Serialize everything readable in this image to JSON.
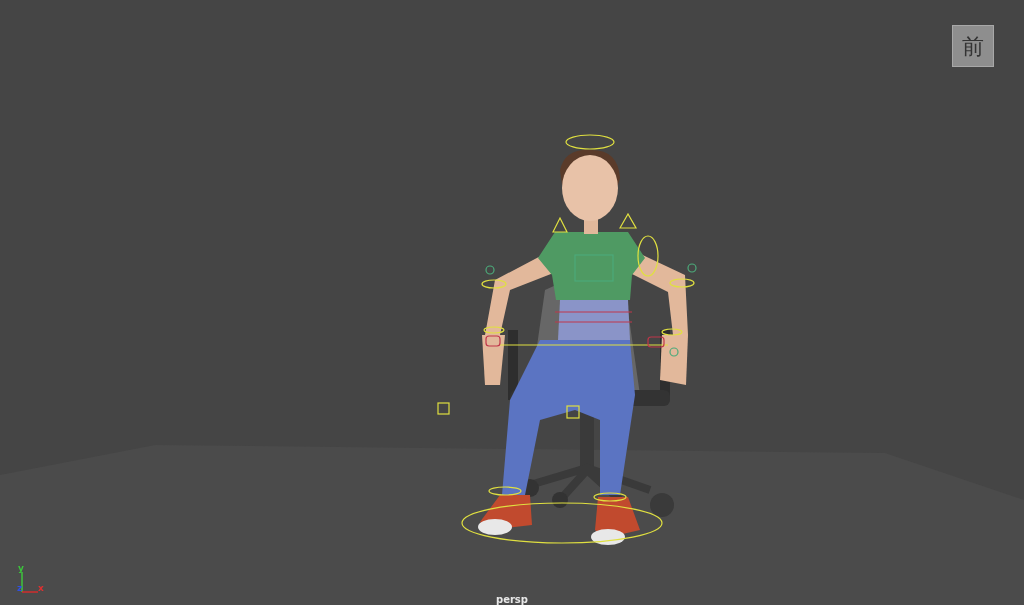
{
  "view_cube": {
    "label": "前"
  },
  "axis_gizmo": {
    "x_label": "x",
    "y_label": "y",
    "z_label": "z"
  },
  "camera_label": "persp"
}
